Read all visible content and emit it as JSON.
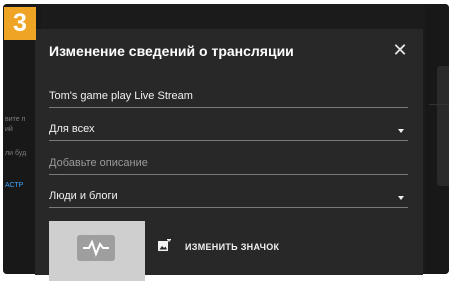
{
  "step_badge": "3",
  "background": {
    "left_texts": [
      "вите п",
      "ий",
      "ли буд"
    ],
    "left_link": "АСТР"
  },
  "dialog": {
    "title": "Изменение сведений о трансляции",
    "close_icon": "close-icon",
    "fields": {
      "title_value": "Tom's game play Live Stream",
      "visibility_value": "Для всех",
      "description_placeholder": "Добавьте описание",
      "category_value": "Люди и блоги"
    },
    "thumbnail": {
      "change_label": "ИЗМЕНИТЬ ЗНАЧОК",
      "icon": "add-photo-icon"
    }
  },
  "colors": {
    "badge": "#f0a425",
    "dialog_bg": "#282828",
    "page_bg": "#1b1b1b"
  }
}
